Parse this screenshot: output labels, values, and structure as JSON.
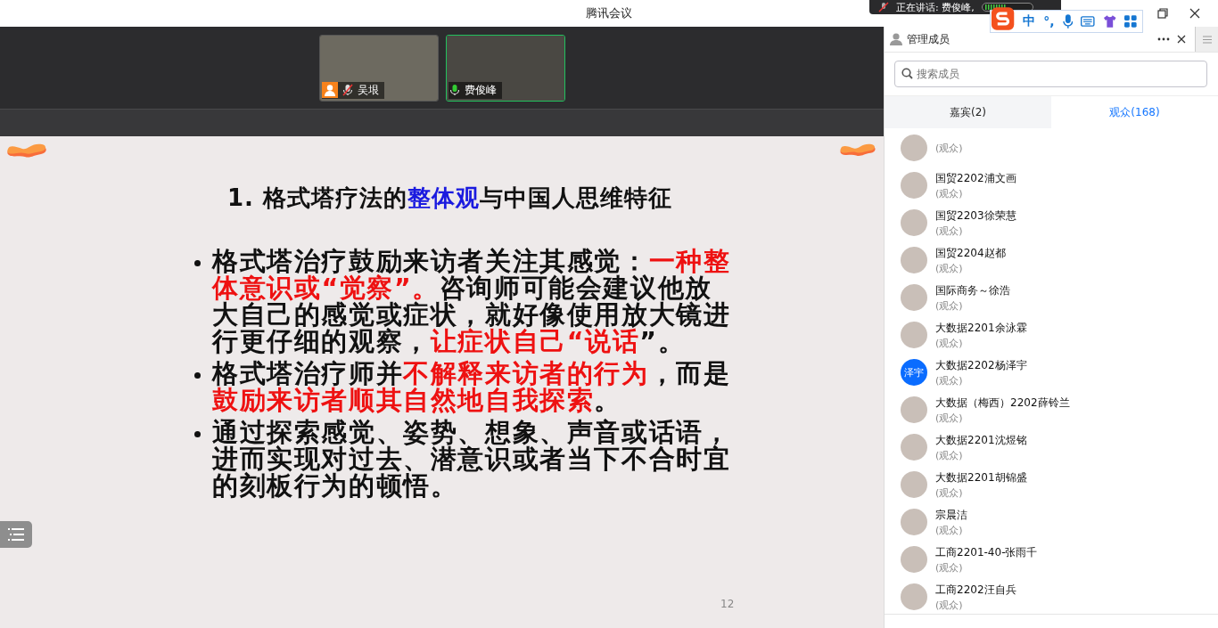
{
  "window": {
    "title": "腾讯会议"
  },
  "speaking_notice": {
    "text": "正在讲话: 费俊峰,"
  },
  "ime_toolbar": {
    "mode": "中",
    "punct": "°,"
  },
  "videos": [
    {
      "name": "吴垠",
      "me": true,
      "muted": true,
      "speaking": false
    },
    {
      "name": "费俊峰",
      "me": false,
      "muted": false,
      "speaking": true
    }
  ],
  "slide": {
    "title": [
      {
        "text": "1.  格式塔疗法的",
        "emphasis": false
      },
      {
        "text": "整体观",
        "emphasis": true
      },
      {
        "text": "与中国人思维特征",
        "emphasis": false
      }
    ],
    "bullets": [
      [
        {
          "text": "格式塔治疗鼓励来访者关注其感觉：",
          "emphasis": false
        },
        {
          "text": "一种整体意识或“觉察”。",
          "emphasis": true
        },
        {
          "text": "咨询师可能会建议他放大自己的感觉或症状，就好像使用放大镜进行更仔细的观察，",
          "emphasis": false
        },
        {
          "text": "让症状自己“说话",
          "emphasis": true
        },
        {
          "text": "”。",
          "emphasis": false
        }
      ],
      [
        {
          "text": "格式塔治疗师并",
          "emphasis": false
        },
        {
          "text": "不解释来访者的行为",
          "emphasis": true
        },
        {
          "text": "，而是",
          "emphasis": false
        },
        {
          "text": "鼓励来访者顺其自然地自我探索",
          "emphasis": true
        },
        {
          "text": "。",
          "emphasis": false
        }
      ],
      [
        {
          "text": "通过探索感觉、姿势、想象、声音或话语，进而实现对过去、潜意识或者当下不合时宜的刻板行为的顿悟。",
          "emphasis": false
        }
      ]
    ],
    "page_number": "12"
  },
  "panel": {
    "title": "管理成员",
    "search": {
      "placeholder": "搜索成员"
    },
    "tabs": [
      {
        "label": "嘉宾(2)",
        "selected": false
      },
      {
        "label": "观众(168)",
        "selected": true
      }
    ],
    "members": [
      {
        "kind": "photo",
        "role": "(观众)"
      },
      {
        "kind": "photo",
        "name": "国贸2202浦文画",
        "role": "(观众)"
      },
      {
        "kind": "photo",
        "name": "国贸2203徐荣慧",
        "role": "(观众)"
      },
      {
        "kind": "photo",
        "name": "国贸2204赵都",
        "role": "(观众)"
      },
      {
        "kind": "photo",
        "name": "国际商务～徐浩",
        "role": "(观众)"
      },
      {
        "kind": "photo",
        "name": "大数据2201余泳霖",
        "role": "(观众)"
      },
      {
        "kind": "initials",
        "initials": "泽宇",
        "name": "大数据2202杨泽宇",
        "role": "(观众)"
      },
      {
        "kind": "photo",
        "name": "大数据（梅西）2202薛铃兰",
        "role": "(观众)"
      },
      {
        "kind": "photo",
        "name": "大数据2201沈煜铭",
        "role": "(观众)"
      },
      {
        "kind": "photo",
        "name": "大数据2201胡锦盛",
        "role": "(观众)"
      },
      {
        "kind": "photo",
        "name": "宗晨洁",
        "role": "(观众)"
      },
      {
        "kind": "photo",
        "name": "工商2201-40-张雨千",
        "role": "(观众)"
      },
      {
        "kind": "photo",
        "name": "工商2202汪自兵",
        "role": "(观众)"
      }
    ]
  }
}
